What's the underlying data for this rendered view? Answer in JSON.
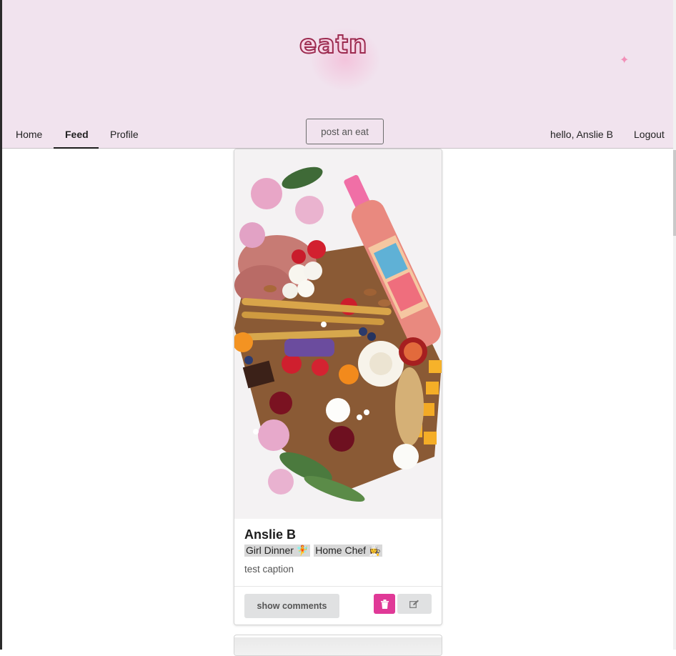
{
  "brand": {
    "logo_text": "eatn",
    "accent": "#e03997",
    "header_bg": "#f1e3ee"
  },
  "nav": {
    "home_label": "Home",
    "feed_label": "Feed",
    "profile_label": "Profile",
    "active": "Feed",
    "post_button": "post an eat",
    "greeting": "hello, Anslie B",
    "logout_label": "Logout"
  },
  "post": {
    "author": "Anslie B",
    "badges": [
      "Girl Dinner 🧚",
      "Home Chef 👩‍🍳"
    ],
    "caption": "test caption",
    "photo_icon": "charcuterie-board-photo",
    "comments_button": "show comments",
    "delete_icon": "trash-icon",
    "edit_icon": "edit-icon"
  }
}
